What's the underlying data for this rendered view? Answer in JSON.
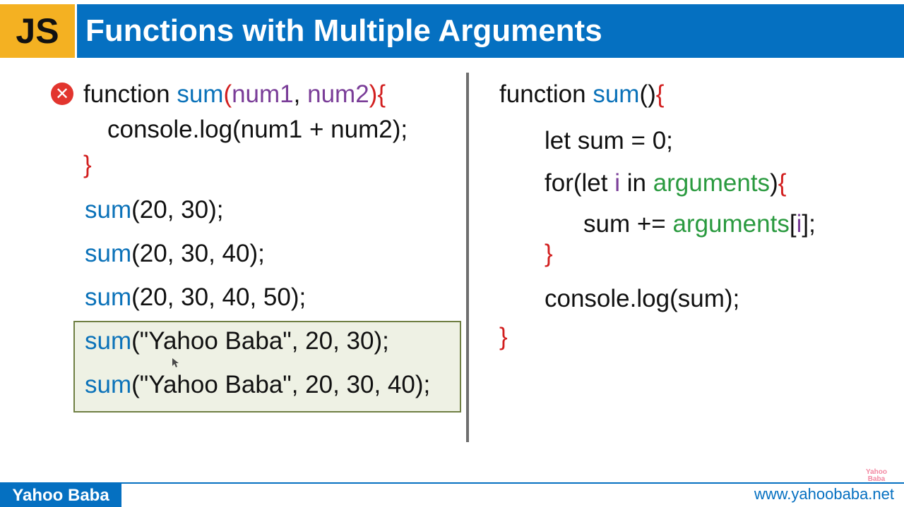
{
  "header": {
    "badge": "JS",
    "title": "Functions with Multiple Arguments"
  },
  "left_code": {
    "fn_keyword": "function ",
    "fn_name": "sum",
    "paren_open": "(",
    "param1": "num1",
    "comma": ", ",
    "param2": "num2",
    "paren_close": ")",
    "brace_open": "{",
    "body": "console.log(num1 + num2);",
    "brace_close": "}",
    "call_name": "sum",
    "call1_args": "(20, 30);",
    "call2_args": "(20, 30, 40);",
    "call3_args": "(20, 30, 40, 50);",
    "call4_args": "(\"Yahoo Baba\", 20, 30);",
    "call5_args": "(\"Yahoo Baba\", 20, 30, 40);"
  },
  "right_code": {
    "fn_keyword": "function ",
    "fn_name": "sum",
    "parens": "()",
    "brace_open": "{",
    "let_line": "let sum = 0;",
    "for_prefix": "for(let ",
    "loop_var": "i",
    "in_kw": " in ",
    "arguments": "arguments",
    "for_close": ")",
    "sum_add": "sum += ",
    "bracket_open": "[",
    "bracket_close": "];",
    "console_line": "console.log(sum);"
  },
  "footer": {
    "brand": "Yahoo Baba",
    "url": "www.yahoobaba.net",
    "watermark_top": "Yahoo",
    "watermark_bottom": "Baba"
  },
  "icons": {
    "error": "error-x-circle-icon",
    "cursor": "mouse-cursor-icon"
  },
  "colors": {
    "badge_bg": "#f4b122",
    "title_bg": "#0570c1",
    "keyword_blue": "#0b72b9",
    "param_purple": "#7a3d98",
    "brace_red": "#d21f1f",
    "arguments_green": "#2a9a3f",
    "error_red": "#e2352e",
    "highlight_bg": "#eef1e4",
    "highlight_border": "#6f7f43"
  }
}
